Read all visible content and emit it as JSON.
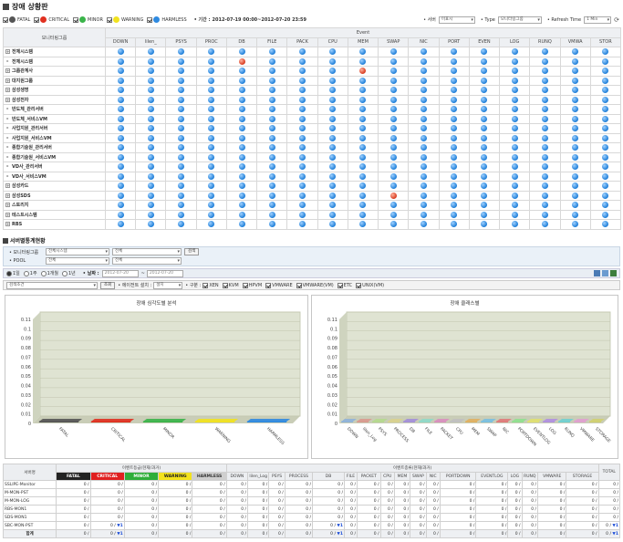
{
  "page": {
    "title": "장애 상황판"
  },
  "filter": {
    "levels": [
      {
        "label": "FATAL",
        "color": "#555555"
      },
      {
        "label": "CRITICAL",
        "color": "#e03020"
      },
      {
        "label": "MINOR",
        "color": "#3bb44a"
      },
      {
        "label": "WARNING",
        "color": "#f1e21f"
      },
      {
        "label": "HARMLESS",
        "color": "#2f8ae0"
      }
    ],
    "period_label": "• 기간 :",
    "period_value": "2012-07-19 00:00~2012-07-20 23:59",
    "server_label": "• 서버",
    "server_value": "미표시",
    "type_label": "• Type",
    "type_value": "모니터링그룹",
    "refresh_label": "• Refresh Time",
    "refresh_value": "1 Min"
  },
  "grid": {
    "group_header": "모니터링그룹",
    "event_header": "Event",
    "columns": [
      "DOWN",
      "lilen_",
      "PSYS",
      "PROC",
      "DB",
      "FILE",
      "PACK",
      "CPU",
      "MEM",
      "SWAP",
      "NIC",
      "PORT",
      "EVEN",
      "LOG",
      "RUNQ",
      "VMWA",
      "STOR"
    ],
    "rows": [
      {
        "name": "전체시스템",
        "tree": "+",
        "red": []
      },
      {
        "name": "전체시스템",
        "tree": "▸",
        "red": [
          4
        ]
      },
      {
        "name": "그룹관계사",
        "tree": "+",
        "red": [
          8
        ]
      },
      {
        "name": "대지원그룹",
        "tree": "+",
        "red": []
      },
      {
        "name": "삼성생명",
        "tree": "+",
        "red": []
      },
      {
        "name": "삼성전자",
        "tree": "+",
        "red": []
      },
      {
        "name": "반도체_관리서버",
        "tree": "▸",
        "red": []
      },
      {
        "name": "반도체_서비스VM",
        "tree": "▸",
        "red": []
      },
      {
        "name": "사업지원_관리서버",
        "tree": "▸",
        "red": []
      },
      {
        "name": "사업지원_서비스VM",
        "tree": "▸",
        "red": []
      },
      {
        "name": "종합기술원_관리서버",
        "tree": "▸",
        "red": []
      },
      {
        "name": "종합기술원_서비스VM",
        "tree": "▸",
        "red": []
      },
      {
        "name": "VD사_관리서버",
        "tree": "▸",
        "red": []
      },
      {
        "name": "VD사_서비스VM",
        "tree": "▸",
        "red": []
      },
      {
        "name": "삼성카드",
        "tree": "+",
        "red": []
      },
      {
        "name": "삼성SDS",
        "tree": "+",
        "red": [
          9
        ]
      },
      {
        "name": "스토리지",
        "tree": "+",
        "red": []
      },
      {
        "name": "테스트시스템",
        "tree": "+",
        "red": []
      },
      {
        "name": "RBS",
        "tree": "+",
        "red": []
      }
    ]
  },
  "server_section": {
    "title": "서버별통계현황"
  },
  "search": {
    "group_label": "• 모니터링그룹",
    "group_value": "전체시스템",
    "group_sub": "전체",
    "pool_label": "• POOL",
    "pool_value": "전체",
    "pool_sub": "전체",
    "search_button": "검색"
  },
  "periods": {
    "options": [
      "1일",
      "1주",
      "1개월",
      "1년"
    ],
    "date_label": "• 날짜 :",
    "from": "2012-07-20",
    "to": "2012-07-20"
  },
  "toolbar2": {
    "search_placeholder": "검색조건",
    "search_button": "조회",
    "agent_label": "• 에이전트 설치 :",
    "agent_value": "설치",
    "type_label": "• 구분 :",
    "types": [
      "XEN",
      "KVM",
      "HPVM",
      "VMWARE",
      "VMWARE(VM)",
      "ETC",
      "UNIX(VM)"
    ]
  },
  "left_chart": {
    "chart_data": {
      "type": "bar",
      "title": "장애 심각도별 분석",
      "categories": [
        "FATAL",
        "CRITICAL",
        "MINOR",
        "WARNING",
        "HARMLESS"
      ],
      "colors": [
        "#555555",
        "#e03020",
        "#3bb44a",
        "#f1e21f",
        "#2f8ae0"
      ],
      "values": [
        0,
        0,
        0,
        0,
        0
      ],
      "ylim": [
        0,
        0.11
      ],
      "yticks": [
        "0.11",
        "0.1",
        "0.09",
        "0.08",
        "0.07",
        "0.06",
        "0.05",
        "0.04",
        "0.03",
        "0.02",
        "0.01",
        "0"
      ]
    }
  },
  "right_chart": {
    "chart_data": {
      "type": "bar",
      "title": "장애 클래스별",
      "categories": [
        "DOWN",
        "lilen_Log",
        "PSYS",
        "PROCESS",
        "DB",
        "FILE",
        "PACKET",
        "CPU",
        "MEM",
        "SWAP",
        "NIC",
        "PORTDOWN",
        "EVENTLOG",
        "LOG",
        "RUNQ",
        "VMWARE",
        "STORAGE"
      ],
      "values": [
        0,
        0,
        0,
        0,
        0,
        0,
        0,
        0,
        0,
        0,
        0,
        0,
        0,
        0,
        0,
        0,
        0
      ],
      "ylim": [
        0,
        0.11
      ],
      "yticks": [
        "0.11",
        "0.1",
        "0.09",
        "0.08",
        "0.07",
        "0.06",
        "0.05",
        "0.04",
        "0.03",
        "0.02",
        "0.01",
        "0"
      ]
    }
  },
  "stats": {
    "col_server": "서버명",
    "group1": "이벤트등급(현재/과거)",
    "group2": "이벤트종류(현재/과거)",
    "total": "TOTAL",
    "sev": [
      {
        "label": "FATAL",
        "bg": "#222222",
        "fg": "#ffffff"
      },
      {
        "label": "CRITICAL",
        "bg": "#e02020",
        "fg": "#ffffff"
      },
      {
        "label": "MINOR",
        "bg": "#2fae3a",
        "fg": "#ffffff"
      },
      {
        "label": "WARNING",
        "bg": "#f3e21c",
        "fg": "#222222"
      },
      {
        "label": "HARMLESS",
        "bg": "#cfcfcf",
        "fg": "#333333"
      }
    ],
    "kinds": [
      "DOWN",
      "lilen_Log",
      "PSYS",
      "PROCESS",
      "DB",
      "FILE",
      "PACKET",
      "CPU",
      "MEM",
      "SWAP",
      "NIC",
      "PORTDOWN",
      "EVENTLOG",
      "LOG",
      "RUNQ",
      "VMWARE",
      "STORAGE"
    ],
    "rows": [
      {
        "name": "SSLIPE-Monitor",
        "vals": [
          "0 /",
          "0 /",
          "0 /",
          "0 /",
          "0 /"
        ],
        "kv": [
          "0 /",
          "0 /",
          "0 /",
          "0 /",
          "0 /",
          "0 /",
          "0 /",
          "0 /",
          "0 /",
          "0 /",
          "0 /",
          "0 /",
          "0 /",
          "0 /",
          "0 /",
          "0 /",
          "0 /"
        ],
        "total": "0 /"
      },
      {
        "name": "M-MON-PST",
        "vals": [
          "0 /",
          "0 /",
          "0 /",
          "0 /",
          "0 /"
        ],
        "kv": [
          "0 /",
          "0 /",
          "0 /",
          "0 /",
          "0 /",
          "0 /",
          "0 /",
          "0 /",
          "0 /",
          "0 /",
          "0 /",
          "0 /",
          "0 /",
          "0 /",
          "0 /",
          "0 /",
          "0 /"
        ],
        "total": "0 /"
      },
      {
        "name": "M-MON-LOG",
        "vals": [
          "0 /",
          "0 /",
          "0 /",
          "0 /",
          "0 /"
        ],
        "kv": [
          "0 /",
          "0 /",
          "0 /",
          "0 /",
          "0 /",
          "0 /",
          "0 /",
          "0 /",
          "0 /",
          "0 /",
          "0 /",
          "0 /",
          "0 /",
          "0 /",
          "0 /",
          "0 /",
          "0 /"
        ],
        "total": "0 /"
      },
      {
        "name": "RBS-MON1",
        "vals": [
          "0 /",
          "0 /",
          "0 /",
          "0 /",
          "0 /"
        ],
        "kv": [
          "0 /",
          "0 /",
          "0 /",
          "0 /",
          "0 /",
          "0 /",
          "0 /",
          "0 /",
          "0 /",
          "0 /",
          "0 /",
          "0 /",
          "0 /",
          "0 /",
          "0 /",
          "0 /",
          "0 /"
        ],
        "total": "0 /"
      },
      {
        "name": "SDS-MON1",
        "vals": [
          "0 /",
          "0 /",
          "0 /",
          "0 /",
          "0 /"
        ],
        "kv": [
          "0 /",
          "0 /",
          "0 /",
          "0 /",
          "0 /",
          "0 /",
          "0 /",
          "0 /",
          "0 /",
          "0 /",
          "0 /",
          "0 /",
          "0 /",
          "0 /",
          "0 /",
          "0 /",
          "0 /"
        ],
        "total": "0 /"
      },
      {
        "name": "SBC-MON-PST",
        "vals": [
          "0 /",
          "0 / ▼1",
          "0 /",
          "0 /",
          "0 /"
        ],
        "kv": [
          "0 /",
          "0 /",
          "0 /",
          "0 /",
          "0 / ▼1",
          "0 /",
          "0 /",
          "0 /",
          "0 /",
          "0 /",
          "0 /",
          "0 /",
          "0 /",
          "0 /",
          "0 /",
          "0 /",
          "0 /"
        ],
        "total": "0 / ▼1"
      }
    ],
    "sum_label": "합계",
    "sum_vals": [
      "0 /",
      "0 / ▼1",
      "0 /",
      "0 /",
      "0 /"
    ],
    "sum_kv": [
      "0 /",
      "0 /",
      "0 /",
      "0 /",
      "0 / ▼1",
      "0 /",
      "0 /",
      "0 /",
      "0 /",
      "0 /",
      "0 /",
      "0 /",
      "0 /",
      "0 /",
      "0 /",
      "0 /",
      "0 /"
    ],
    "sum_total": "0 / ▼1"
  }
}
